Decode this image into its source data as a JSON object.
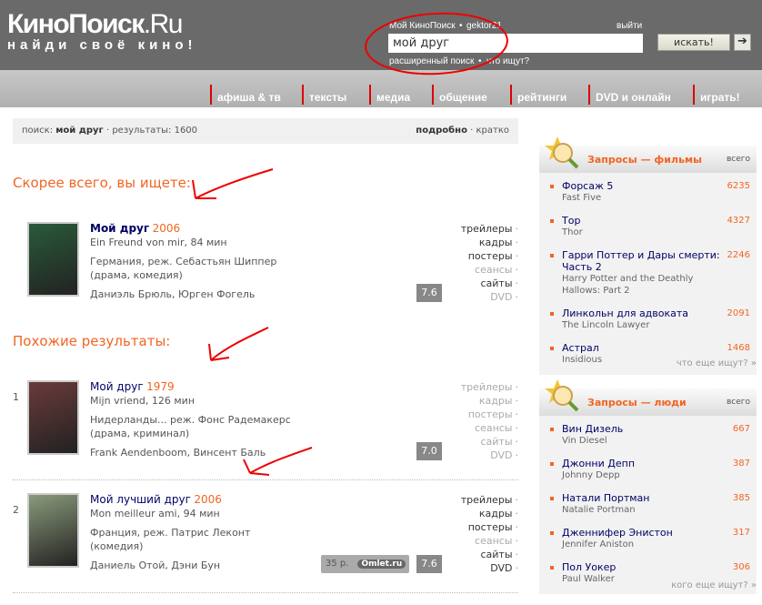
{
  "header": {
    "logo_main": "КиноПоиск",
    "logo_suffix": ".Ru",
    "tagline": "найди своё кино!",
    "my_kp": "Мой КиноПоиск",
    "username": "gektor21",
    "logout": "выйти",
    "search_value": "мой друг",
    "search_button": "искать!",
    "advanced": "расширенный поиск",
    "whats_searched": "что ищут?"
  },
  "nav": [
    "афиша & тв",
    "тексты",
    "медиа",
    "общение",
    "рейтинги",
    "DVD и онлайн",
    "играть!"
  ],
  "searchbar": {
    "label": "поиск:",
    "query": "мой друг",
    "results_label": "результаты:",
    "count": "1600",
    "detailed": "подробно",
    "brief": "кратко"
  },
  "main": {
    "likely_heading": "Скорее всего, вы ищете:",
    "similar_heading": "Похожие результаты:",
    "films": [
      {
        "num": "",
        "title": "Мой друг",
        "year": "2006",
        "orig": "Ein Freund von mir, 84 мин",
        "country": "Германия, реж. Себастьян Шиппер",
        "genre": "(драма, комедия)",
        "cast": "Даниэль Брюль, Юрген Фогель",
        "rating": "7.6",
        "poster_color": "#2a5a3a"
      },
      {
        "num": "1",
        "title": "Мой друг",
        "year": "1979",
        "orig": "Mijn vriend, 126 мин",
        "country": "Нидерланды... реж. Фонс Радемакерс",
        "genre": "(драма, криминал)",
        "cast": "Frank Aendenboom, Винсент Баль",
        "rating": "7.0",
        "poster_color": "#6a3a3a"
      },
      {
        "num": "2",
        "title": "Мой лучший друг",
        "year": "2006",
        "orig": "Mon meilleur ami, 94 мин",
        "country": "Франция, реж. Патрис Леконт",
        "genre": "(комедия)",
        "cast": "Даниель Отой, Дэни Бун",
        "rating": "7.6",
        "price": "35 р.",
        "shop": "Omlet.ru",
        "poster_color": "#8a9a7a"
      }
    ],
    "link_labels": [
      "трейлеры",
      "кадры",
      "постеры",
      "сеансы",
      "сайты",
      "DVD"
    ],
    "link_enabled": [
      [
        true,
        true,
        true,
        false,
        true,
        false
      ],
      [
        false,
        false,
        false,
        false,
        false,
        false
      ],
      [
        true,
        true,
        true,
        false,
        true,
        true
      ]
    ]
  },
  "films_panel": {
    "title": "Запросы — фильмы",
    "total": "всего",
    "more": "что еще ищут?",
    "items": [
      {
        "t": "Форсаж 5",
        "s": "Fast Five",
        "c": "6235"
      },
      {
        "t": "Тор",
        "s": "Thor",
        "c": "4327"
      },
      {
        "t": "Гарри Поттер и Дары смерти: Часть 2",
        "s": "Harry Potter and the Deathly Hallows: Part 2",
        "c": "2246"
      },
      {
        "t": "Линкольн для адвоката",
        "s": "The Lincoln Lawyer",
        "c": "2091"
      },
      {
        "t": "Астрал",
        "s": "Insidious",
        "c": "1468"
      }
    ]
  },
  "people_panel": {
    "title": "Запросы — люди",
    "total": "всего",
    "more": "кого еще ищут?",
    "items": [
      {
        "t": "Вин Дизель",
        "s": "Vin Diesel",
        "c": "667"
      },
      {
        "t": "Джонни Депп",
        "s": "Johnny Depp",
        "c": "387"
      },
      {
        "t": "Натали Портман",
        "s": "Natalie Portman",
        "c": "385"
      },
      {
        "t": "Дженнифер Энистон",
        "s": "Jennifer Aniston",
        "c": "317"
      },
      {
        "t": "Пол Уокер",
        "s": "Paul Walker",
        "c": "306"
      }
    ]
  },
  "colors": {
    "accent": "#f26522",
    "header": "#6a6a6a",
    "annotation": "#e00000"
  }
}
